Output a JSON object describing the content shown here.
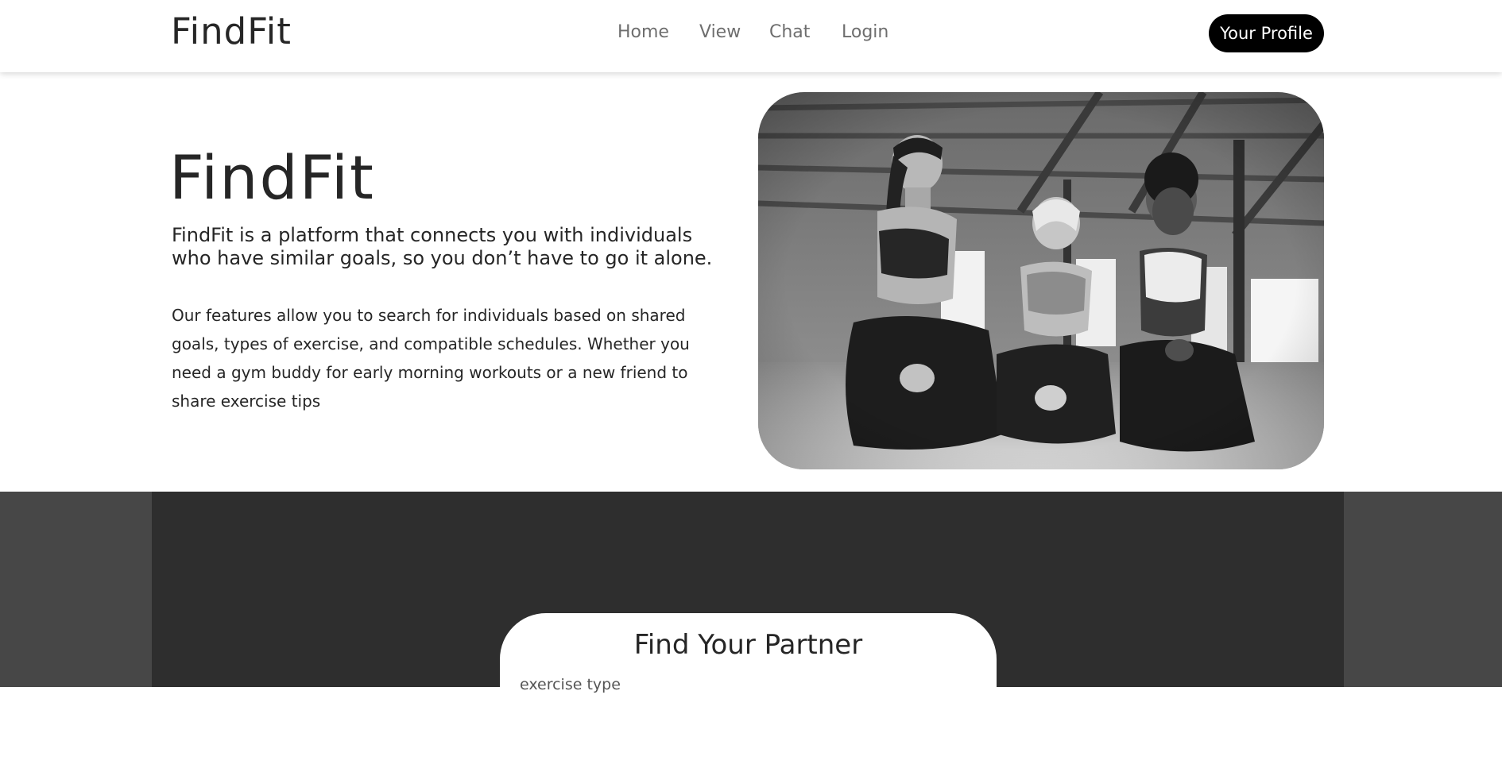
{
  "header": {
    "logo": "FindFit",
    "nav": [
      "Home",
      "View",
      "Chat",
      "Login"
    ],
    "profile_button": "Your Profile"
  },
  "hero": {
    "title": "FindFit",
    "lead": "FindFit is a platform that connects you with individuals who have similar goals, so you don’t have to go it alone.",
    "body": "Our features allow you to search for individuals based on shared goals, types of exercise, and compatible schedules. Whether you need a gym buddy for early morning workouts or a new friend to share exercise tips",
    "image_icon": "photo-three-women-gym"
  },
  "partner": {
    "title": "Find Your Partner",
    "first_field_label": "exercise type"
  },
  "colors": {
    "text": "#262626",
    "nav_text": "#6e6e6e",
    "button_bg": "#000000",
    "dark_outer": "#474747",
    "dark_inner": "#2e2e2e",
    "card_bg": "#ffffff"
  }
}
